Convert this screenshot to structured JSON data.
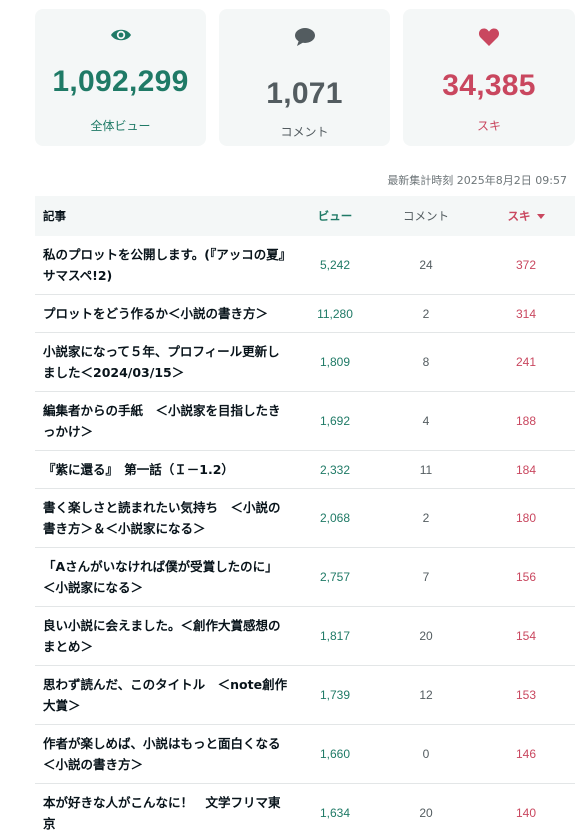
{
  "summary": {
    "views": {
      "value": "1,092,299",
      "label": "全体ビュー",
      "icon": "eye-icon",
      "color": "#1f7a66"
    },
    "comments": {
      "value": "1,071",
      "label": "コメント",
      "icon": "comment-icon",
      "color": "#535c60"
    },
    "likes": {
      "value": "34,385",
      "label": "スキ",
      "icon": "heart-icon",
      "color": "#c9475f"
    }
  },
  "updated_at": "最新集計時刻 2025年8月2日 09:57",
  "table": {
    "headers": {
      "title": "記事",
      "views": "ビュー",
      "comments": "コメント",
      "likes": "スキ"
    },
    "sort": {
      "column": "likes",
      "direction": "desc"
    },
    "rows": [
      {
        "title": "私のプロットを公開します。(『アッコの夏』サマスペ!2)",
        "views": "5,242",
        "comments": "24",
        "likes": "372"
      },
      {
        "title": "プロットをどう作るか＜小説の書き方＞",
        "views": "11,280",
        "comments": "2",
        "likes": "314"
      },
      {
        "title": "小説家になって５年、プロフィール更新しました＜2024/03/15＞",
        "views": "1,809",
        "comments": "8",
        "likes": "241"
      },
      {
        "title": "編集者からの手紙　＜小説家を目指したきっかけ＞",
        "views": "1,692",
        "comments": "4",
        "likes": "188"
      },
      {
        "title": "『紫に還る』　第一話（Ｉ－1.2）",
        "views": "2,332",
        "comments": "11",
        "likes": "184"
      },
      {
        "title": "書く楽しさと読まれたい気持ち　＜小説の書き方＞＆＜小説家になる＞",
        "views": "2,068",
        "comments": "2",
        "likes": "180"
      },
      {
        "title": "「Aさんがいなければ僕が受賞したのに」＜小説家になる＞",
        "views": "2,757",
        "comments": "7",
        "likes": "156"
      },
      {
        "title": "良い小説に会えました。＜創作大賞感想のまとめ＞",
        "views": "1,817",
        "comments": "20",
        "likes": "154"
      },
      {
        "title": "思わず読んだ、このタイトル　＜note創作大賞＞",
        "views": "1,739",
        "comments": "12",
        "likes": "153"
      },
      {
        "title": "作者が楽しめば、小説はもっと面白くなる　＜小説の書き方＞",
        "views": "1,660",
        "comments": "0",
        "likes": "146"
      },
      {
        "title": "本が好きな人がこんなに！　文学フリマ東京",
        "views": "1,634",
        "comments": "20",
        "likes": "140"
      }
    ]
  }
}
